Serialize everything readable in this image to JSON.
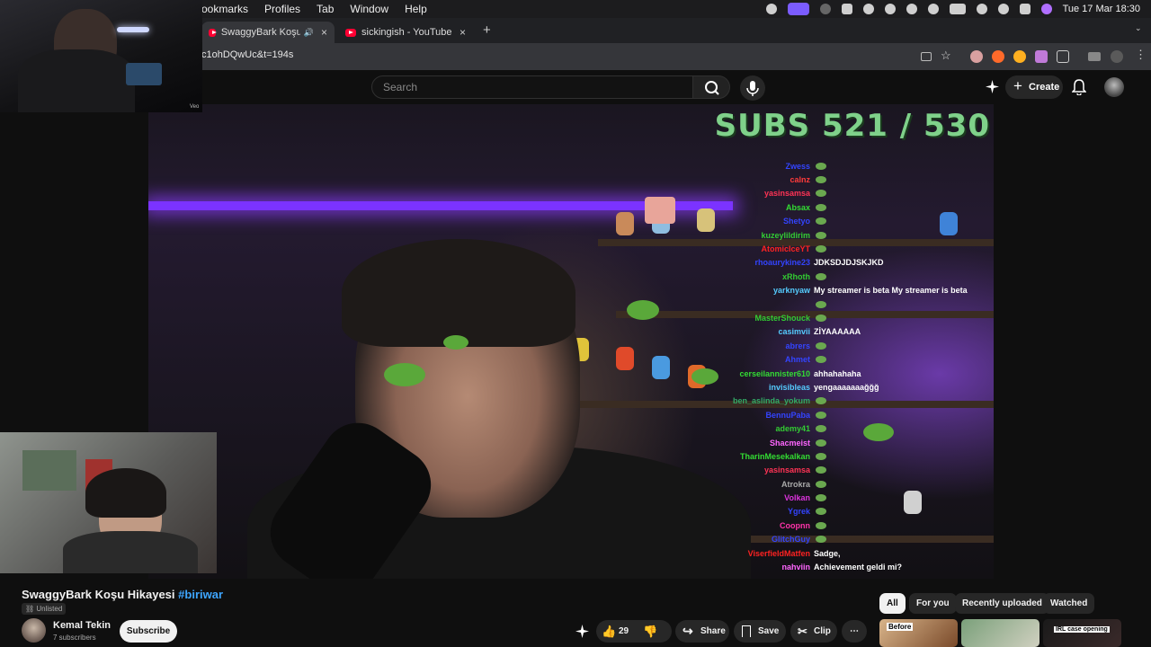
{
  "menubar": {
    "items": [
      "ookmarks",
      "Profiles",
      "Tab",
      "Window",
      "Help"
    ],
    "clock": "Tue 17 Mar  18:30"
  },
  "tabs": [
    {
      "title": "SwaggyBark Koşu Hikayesi",
      "active": true
    },
    {
      "title": "sickingish - YouTube",
      "active": false
    }
  ],
  "address": {
    "url": "c1ohDQwUc&t=194s"
  },
  "youtube": {
    "search_placeholder": "Search",
    "create_label": "Create"
  },
  "overlay": {
    "subs": "SUBS 521 / 530",
    "chat": [
      {
        "user": "Zwess",
        "color": "#3344ff",
        "msg": ""
      },
      {
        "user": "calnz",
        "color": "#ff3b3b",
        "msg": ""
      },
      {
        "user": "yasinsamsa",
        "color": "#ff3355",
        "msg": ""
      },
      {
        "user": "Absax",
        "color": "#33dd33",
        "msg": ""
      },
      {
        "user": "Shetyo",
        "color": "#3344ff",
        "msg": ""
      },
      {
        "user": "kuzeylildirim",
        "color": "#33cc33",
        "msg": ""
      },
      {
        "user": "AtomicIceYT",
        "color": "#ff2222",
        "msg": ""
      },
      {
        "user": "rhoaurykine23",
        "color": "#3344ff",
        "msg": "JDKSDJDJSKJKD"
      },
      {
        "user": "xRhoth",
        "color": "#33cc33",
        "msg": ""
      },
      {
        "user": "yarknyaw",
        "color": "#55ccff",
        "msg": "My streamer is beta  My streamer is beta"
      },
      {
        "user": "",
        "color": "#ffffff",
        "msg": ""
      },
      {
        "user": "MasterShouck",
        "color": "#33cc33",
        "msg": ""
      },
      {
        "user": "casimvii",
        "color": "#55ccff",
        "msg": "ZİYAAAAAA"
      },
      {
        "user": "abrers",
        "color": "#3344ff",
        "msg": ""
      },
      {
        "user": "Ahmet",
        "color": "#3344ff",
        "msg": ""
      },
      {
        "user": "cerseilannister610",
        "color": "#33dd33",
        "msg": "ahhahahaha"
      },
      {
        "user": "invisibleas",
        "color": "#55ccff",
        "msg": "yengaaaaaaağğğ"
      },
      {
        "user": "ben_aslinda_yokum",
        "color": "#33aa66",
        "msg": ""
      },
      {
        "user": "BennuPaba",
        "color": "#3344ff",
        "msg": ""
      },
      {
        "user": "ademy41",
        "color": "#33cc33",
        "msg": ""
      },
      {
        "user": "Shacmeist",
        "color": "#ff66ff",
        "msg": ""
      },
      {
        "user": "TharinMesekalkan",
        "color": "#33dd33",
        "msg": ""
      },
      {
        "user": "yasinsamsa",
        "color": "#ff3355",
        "msg": ""
      },
      {
        "user": "Atrokra",
        "color": "#aaaaaa",
        "msg": ""
      },
      {
        "user": "Volkan",
        "color": "#dd33dd",
        "msg": ""
      },
      {
        "user": "Ygrek",
        "color": "#3344ff",
        "msg": ""
      },
      {
        "user": "Coopnn",
        "color": "#ff33aa",
        "msg": ""
      },
      {
        "user": "GlitchGuy",
        "color": "#3344ff",
        "msg": ""
      },
      {
        "user": "ViserfieldMatfen",
        "color": "#ff2222",
        "msg": "Sadge,"
      },
      {
        "user": "nahviin",
        "color": "#ff66ff",
        "msg": "Achievement geldi mi?"
      }
    ]
  },
  "video": {
    "title": "SwaggyBark Koşu Hikayesi",
    "hashtag": "#biriwar",
    "visibility": "Unlisted",
    "channel": "Kemal Tekin",
    "subscribers": "7 subscribers",
    "subscribe_label": "Subscribe",
    "likes": "29",
    "share_label": "Share",
    "save_label": "Save",
    "clip_label": "Clip"
  },
  "chips": [
    "All",
    "For you",
    "Recently uploaded",
    "Watched"
  ],
  "thumbnails": [
    {
      "caption": "Before"
    },
    {
      "caption": ""
    },
    {
      "caption": "IRL case opening"
    }
  ],
  "cam_top": {
    "watermark": "Veo"
  },
  "colors": {
    "accent": "#ff0033",
    "link": "#3ea6ff",
    "neon": "#7b33ff",
    "subs": "#7fd18a"
  }
}
